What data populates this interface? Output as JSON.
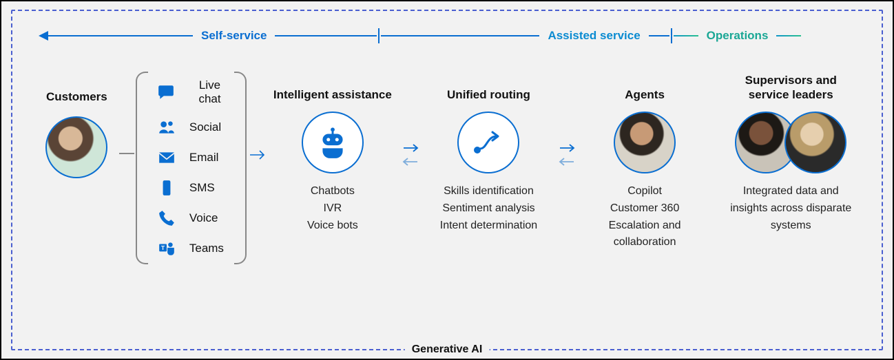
{
  "timeline": {
    "self_service": "Self-service",
    "assisted_service": "Assisted service",
    "operations": "Operations"
  },
  "customers": {
    "title": "Customers"
  },
  "channels": [
    {
      "icon": "chat-icon",
      "label": "Live chat"
    },
    {
      "icon": "social-icon",
      "label": "Social"
    },
    {
      "icon": "email-icon",
      "label": "Email"
    },
    {
      "icon": "sms-icon",
      "label": "SMS"
    },
    {
      "icon": "voice-icon",
      "label": "Voice"
    },
    {
      "icon": "teams-icon",
      "label": "Teams"
    }
  ],
  "intelligent": {
    "title": "Intelligent assistance",
    "items": [
      "Chatbots",
      "IVR",
      "Voice bots"
    ]
  },
  "routing": {
    "title": "Unified routing",
    "items": [
      "Skills identification",
      "Sentiment analysis",
      "Intent determination"
    ]
  },
  "agents": {
    "title": "Agents",
    "items": [
      "Copilot",
      "Customer 360",
      "Escalation and collaboration"
    ]
  },
  "supervisors": {
    "title": "Supervisors and service leaders",
    "desc": "Integrated data and insights across disparate systems"
  },
  "footer": "Generative AI"
}
